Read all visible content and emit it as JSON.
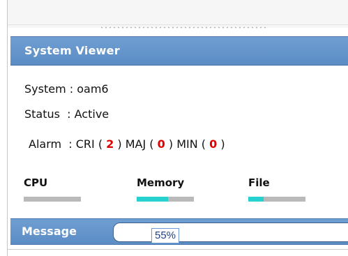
{
  "viewer": {
    "title": "System Viewer",
    "system_label": "System",
    "system_value": "oam6",
    "status_label": "Status",
    "status_value": "Active",
    "alarm": {
      "label": "Alarm",
      "cri_label": "CRI",
      "cri_value": "2",
      "maj_label": "MAJ",
      "maj_value": "0",
      "min_label": "MIN",
      "min_value": "0"
    },
    "resources": [
      {
        "label": "CPU",
        "fill": 0
      },
      {
        "label": "Memory",
        "fill": 0.55
      },
      {
        "label": "File",
        "fill": 0.27
      }
    ]
  },
  "message": {
    "label": "Message",
    "value": ""
  },
  "tooltip": {
    "text": "55%"
  },
  "colors": {
    "title_bar": "#6f9fd2",
    "alarm_value": "#e00000",
    "bar_track": "#b9b9b9",
    "bar_fill": "#25d1d1"
  }
}
